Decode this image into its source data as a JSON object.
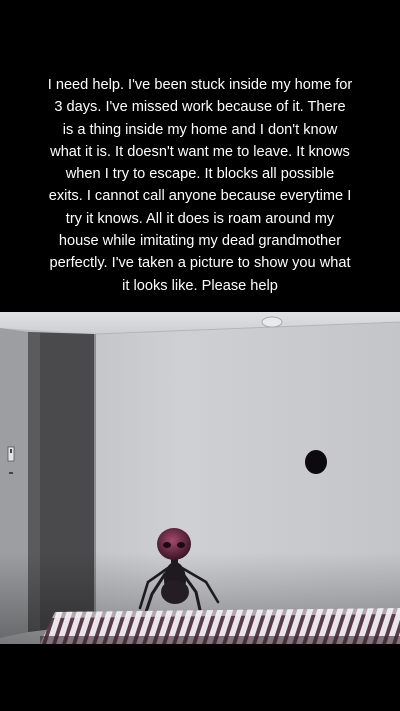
{
  "post": {
    "text": "I need help. I've been stuck inside my home for\n3 days. I've missed work because of it. There\nis a thing inside my home and I don't know\nwhat it is. It doesn't want me to leave. It knows\nwhen I try to escape. It blocks all possible\nexits. I cannot call anyone because everytime I\ntry it knows. All it does is roam around my\nhouse while imitating my dead grandmother\nperfectly. I've taken a picture to show you what\nit looks like. Please help"
  },
  "photo": {
    "colors": {
      "wall": "#c9cacc",
      "ceiling": "#d9dadc",
      "door": "#4a4a4c",
      "bed_stripe_dark": "#5a3c46",
      "bed_stripe_light": "#e8e6ea",
      "figure": "#1e1a1e",
      "figure_head": "#7a2a4a"
    }
  }
}
